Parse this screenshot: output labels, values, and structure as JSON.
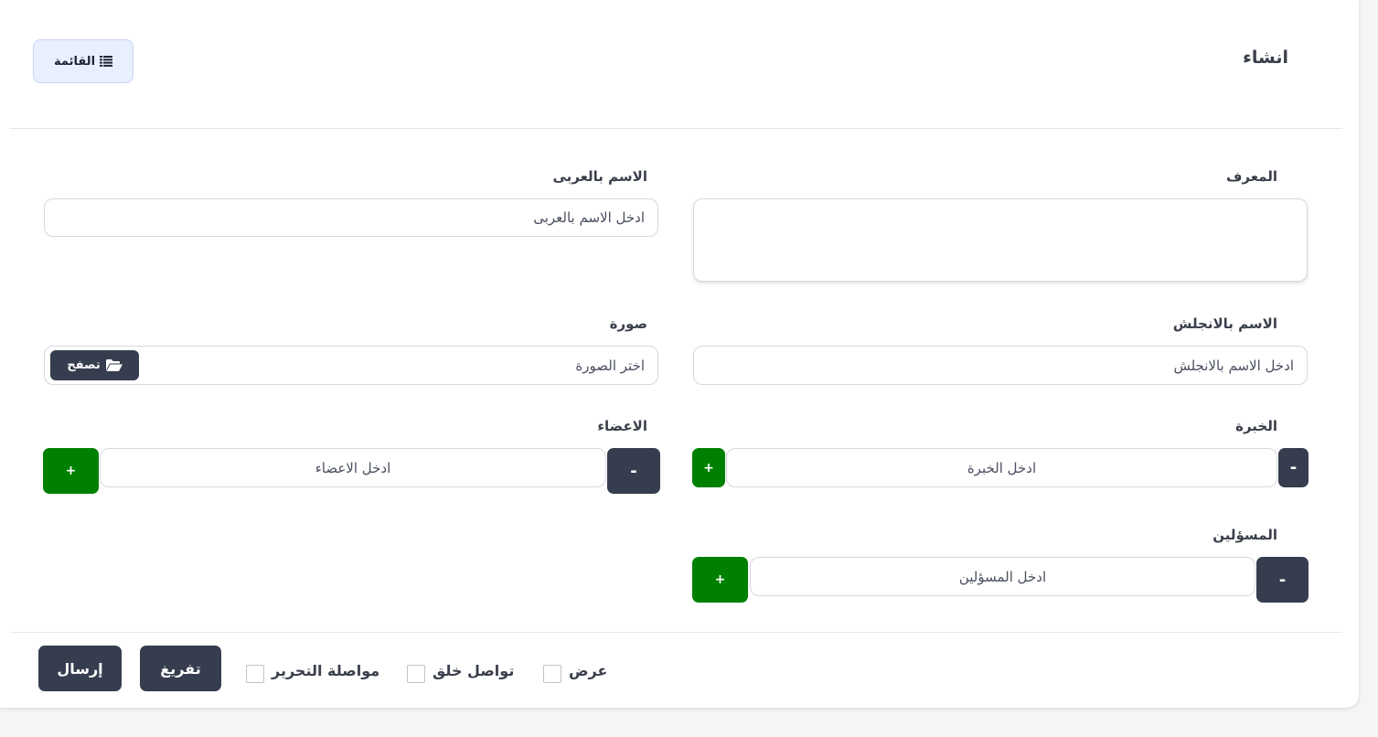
{
  "header": {
    "title": "انشاء",
    "list_button_label": "القائمة",
    "list_icon": "list-icon"
  },
  "form": {
    "id_field": {
      "label": "المعرف",
      "value": ""
    },
    "name_ar": {
      "label": "الاسم بالعربى",
      "placeholder": "ادخل الاسم بالعربى"
    },
    "name_en": {
      "label": "الاسم بالانجلش",
      "placeholder": "ادخل الاسم بالانجلش"
    },
    "image": {
      "label": "صورة",
      "placeholder": "اختر الصورة",
      "browse_label": "تصفح",
      "browse_icon": "folder-open-icon"
    },
    "experience": {
      "label": "الخبرة",
      "placeholder": "ادخل الخبرة",
      "add_label": "+",
      "remove_label": "-"
    },
    "members": {
      "label": "الاعضاء",
      "placeholder": "ادخل الاعضاء",
      "add_label": "+",
      "remove_label": "-"
    },
    "officials": {
      "label": "المسؤلين",
      "placeholder": "ادخل المسؤلين",
      "add_label": "+",
      "remove_label": "-"
    }
  },
  "footer": {
    "checkboxes": {
      "view": {
        "label": "عرض",
        "checked": false
      },
      "continue_create": {
        "label": "تواصل خلق",
        "checked": false
      },
      "continue_edit": {
        "label": "مواصلة التحرير",
        "checked": false
      }
    },
    "reset_label": "تفريغ",
    "submit_label": "إرسال"
  },
  "colors": {
    "dark_button": "#363d4e",
    "add_button": "#008000",
    "list_button_bg": "#e8efff"
  }
}
